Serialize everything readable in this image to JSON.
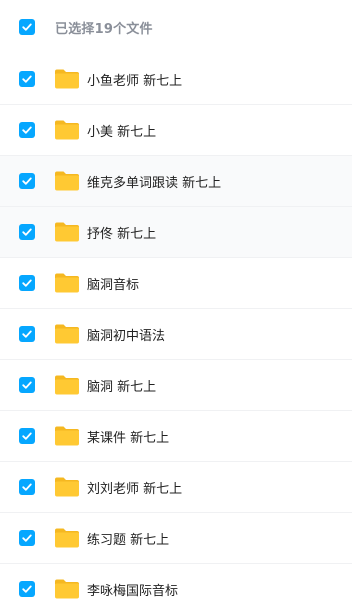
{
  "header": {
    "title": "已选择19个文件"
  },
  "items": [
    {
      "label": "小鱼老师 新七上",
      "checked": true
    },
    {
      "label": "小美 新七上",
      "checked": true
    },
    {
      "label": "维克多单词跟读 新七上",
      "checked": true
    },
    {
      "label": "抒佟 新七上",
      "checked": true
    },
    {
      "label": "脑洞音标",
      "checked": true
    },
    {
      "label": "脑洞初中语法",
      "checked": true
    },
    {
      "label": "脑洞 新七上",
      "checked": true
    },
    {
      "label": "某课件 新七上",
      "checked": true
    },
    {
      "label": "刘刘老师 新七上",
      "checked": true
    },
    {
      "label": "练习题 新七上",
      "checked": true
    },
    {
      "label": "李咏梅国际音标",
      "checked": true
    }
  ],
  "colors": {
    "accent": "#06a7ff",
    "folder": "#ffc933",
    "folder_tab": "#f5b821"
  }
}
